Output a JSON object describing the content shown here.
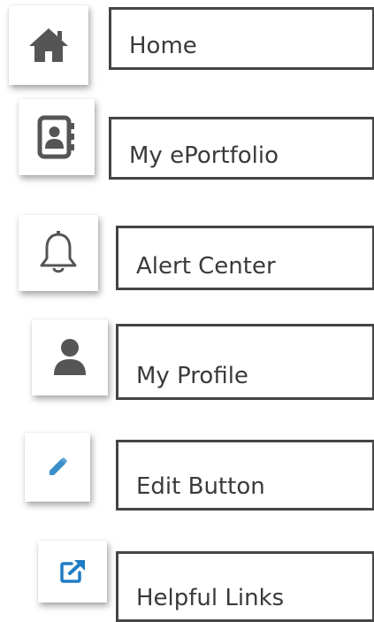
{
  "menu": {
    "items": [
      {
        "label": "Home",
        "icon": "home-icon"
      },
      {
        "label": "My ePortfolio",
        "icon": "address-book-icon"
      },
      {
        "label": "Alert Center",
        "icon": "bell-icon"
      },
      {
        "label": "My Profile",
        "icon": "user-icon"
      },
      {
        "label": "Edit Button",
        "icon": "pencil-icon"
      },
      {
        "label": "Helpful Links",
        "icon": "external-link-icon"
      }
    ]
  },
  "colors": {
    "border": "#454545",
    "text": "#3a3a3a",
    "icon_gray": "#555555",
    "pencil_blue": "#3a8fc9",
    "link_blue": "#1f7dc4"
  }
}
